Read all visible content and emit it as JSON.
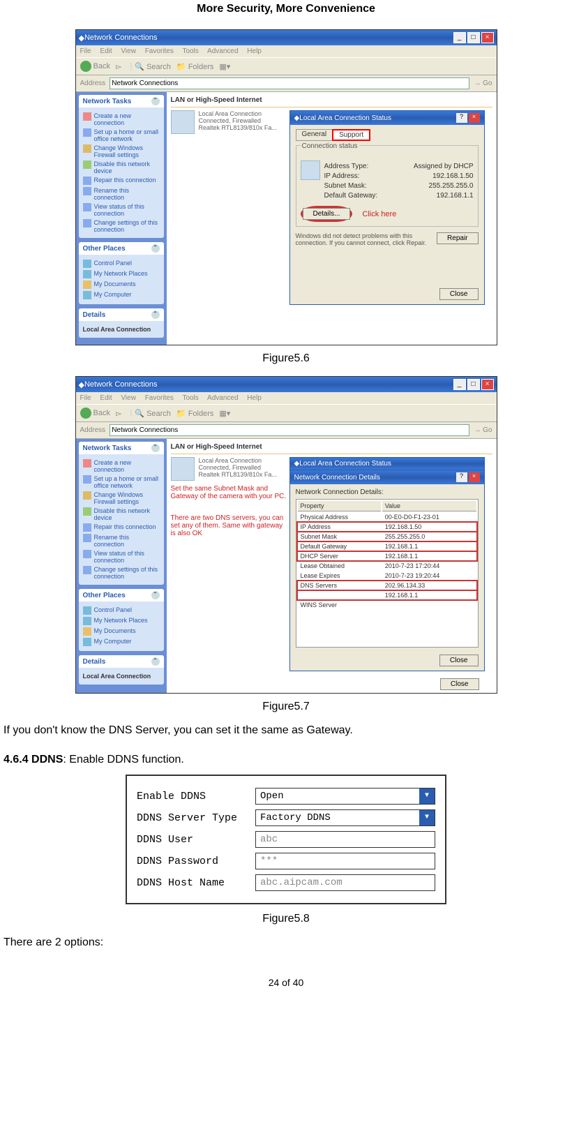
{
  "header": "More Security, More Convenience",
  "fig56": {
    "window_title": "Network Connections",
    "menu": [
      "File",
      "Edit",
      "View",
      "Favorites",
      "Tools",
      "Advanced",
      "Help"
    ],
    "toolbar": {
      "back": "Back",
      "search": "Search",
      "folders": "Folders"
    },
    "address_label": "Address",
    "address_value": "Network Connections",
    "go": "Go",
    "side": {
      "tasks_head": "Network Tasks",
      "tasks": [
        "Create a new connection",
        "Set up a home or small office network",
        "Change Windows Firewall settings",
        "Disable this network device",
        "Repair this connection",
        "Rename this connection",
        "View status of this connection",
        "Change settings of this connection"
      ],
      "other_head": "Other Places",
      "other": [
        "Control Panel",
        "My Network Places",
        "My Documents",
        "My Computer"
      ],
      "details_head": "Details",
      "details_item": "Local Area Connection"
    },
    "lan_header": "LAN or High-Speed Internet",
    "conn": {
      "name": "Local Area Connection",
      "state": "Connected, Firewalled",
      "device": "Realtek RTL8139/810x Fa..."
    },
    "status_dlg": {
      "title": "Local Area Connection Status",
      "tab_general": "General",
      "tab_support": "Support",
      "section": "Connection status",
      "rows": [
        {
          "k": "Address Type:",
          "v": "Assigned by DHCP"
        },
        {
          "k": "IP Address:",
          "v": "192.168.1.50"
        },
        {
          "k": "Subnet Mask:",
          "v": "255.255.255.0"
        },
        {
          "k": "Default Gateway:",
          "v": "192.168.1.1"
        }
      ],
      "details_btn": "Details...",
      "click_here": "Click here",
      "note": "Windows did not detect problems with this connection. If you cannot connect, click Repair.",
      "repair_btn": "Repair",
      "close_btn": "Close"
    },
    "caption": "Figure5.6"
  },
  "fig57": {
    "annot1": "Set the same Subnet Mask and Gateway of the camera with your PC.",
    "annot2": "There are two DNS servers, you can set any of them. Same with gateway is also OK",
    "details_dlg": {
      "title": "Network Connection Details",
      "subtitle": "Network Connection Details:",
      "prop_h": "Property",
      "val_h": "Value",
      "rows": [
        {
          "k": "Physical Address",
          "v": "00-E0-D0-F1-23-01"
        },
        {
          "k": "IP Address",
          "v": "192.168.1.50"
        },
        {
          "k": "Subnet Mask",
          "v": "255.255.255.0"
        },
        {
          "k": "Default Gateway",
          "v": "192.168.1.1"
        },
        {
          "k": "DHCP Server",
          "v": "192.168.1.1"
        },
        {
          "k": "Lease Obtained",
          "v": "2010-7-23 17:20:44"
        },
        {
          "k": "Lease Expires",
          "v": "2010-7-23 19:20:44"
        },
        {
          "k": "DNS Servers",
          "v": "202.96.134.33"
        },
        {
          "k": "",
          "v": "192.168.1.1"
        },
        {
          "k": "WINS Server",
          "v": ""
        }
      ],
      "close_btn": "Close",
      "outer_close": "Close"
    },
    "caption": "Figure5.7"
  },
  "text_after_57": "If you don't know the DNS Server, you can set it the same as Gateway.",
  "sect_464": {
    "num": "4.6.4 DDNS",
    "rest": ": Enable DDNS function."
  },
  "ddns": {
    "rows": [
      {
        "label": "Enable DDNS",
        "value": "Open",
        "sel": true,
        "active": true
      },
      {
        "label": "DDNS Server Type",
        "value": "Factory DDNS",
        "sel": true,
        "active": true
      },
      {
        "label": "DDNS User",
        "value": "abc",
        "sel": false,
        "active": false
      },
      {
        "label": "DDNS Password",
        "value": "***",
        "sel": false,
        "active": false
      },
      {
        "label": "DDNS Host Name",
        "value": "abc.aipcam.com",
        "sel": false,
        "active": false
      }
    ],
    "caption": "Figure5.8"
  },
  "text_after_58": "There are 2 options:",
  "footer": "24 of 40"
}
